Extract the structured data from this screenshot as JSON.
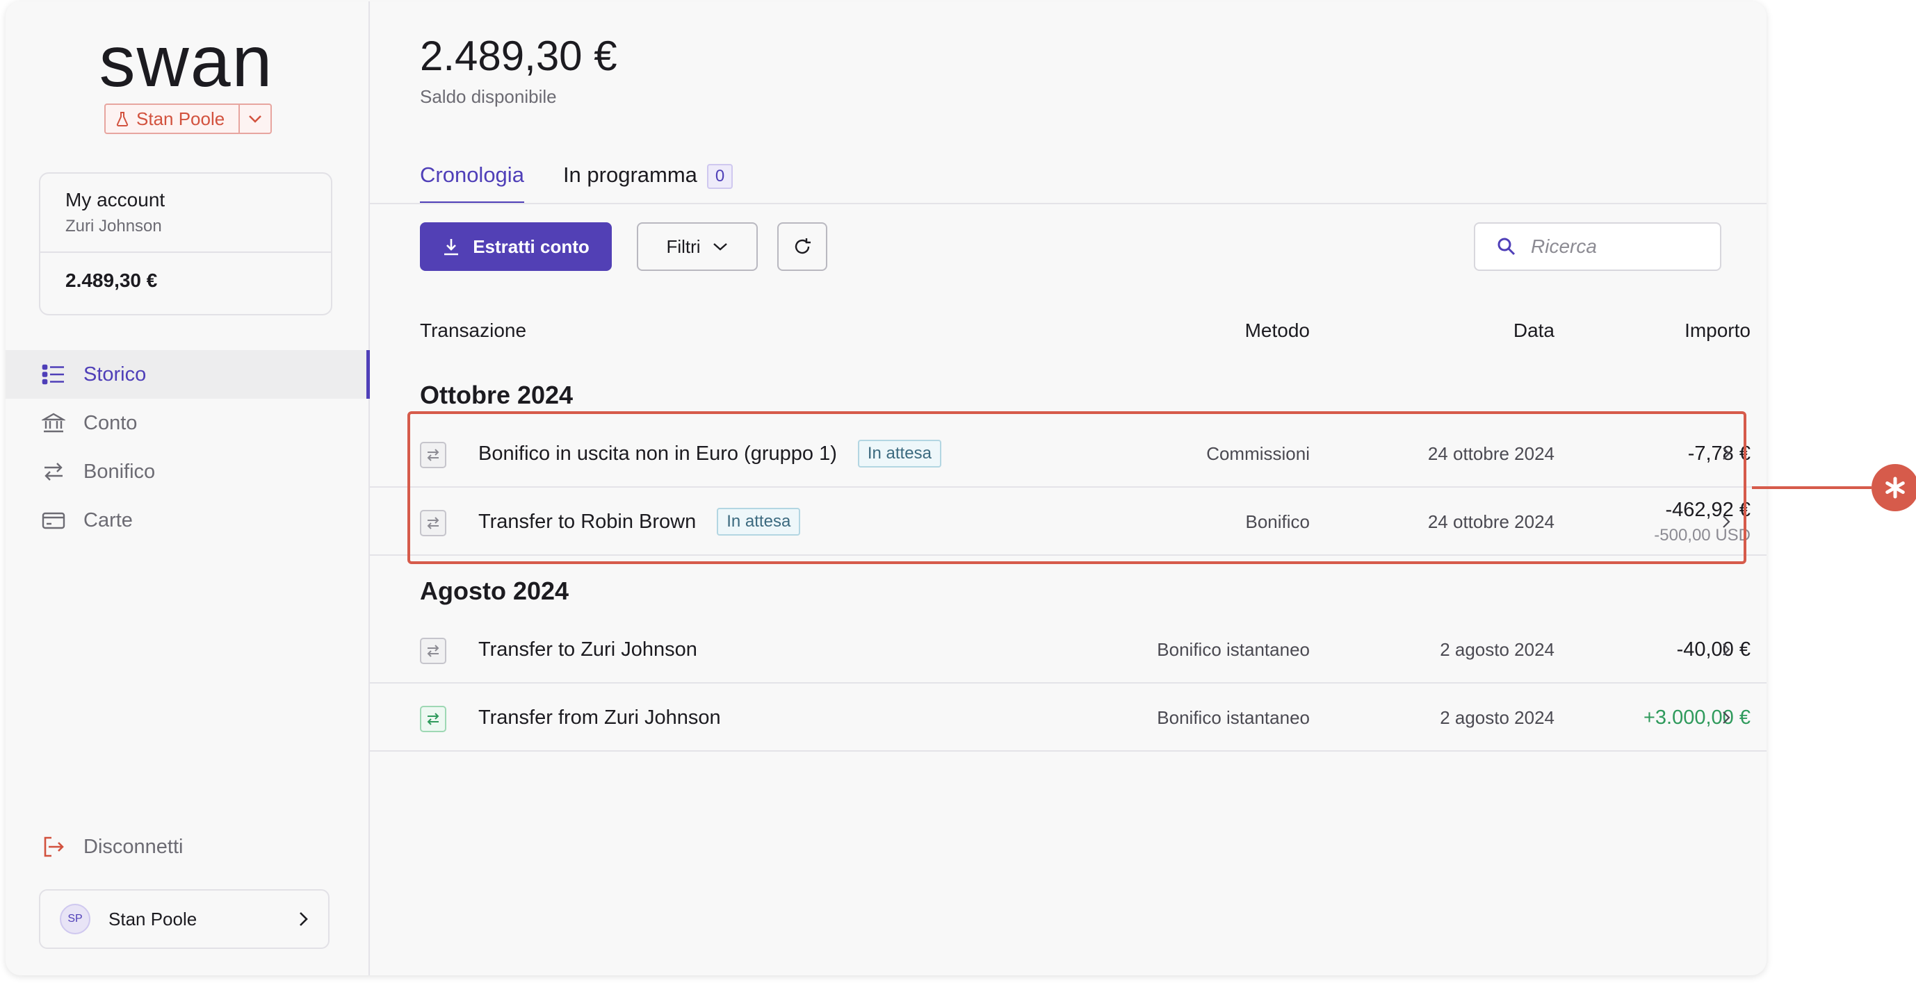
{
  "brand": {
    "logo_text": "swan"
  },
  "project": {
    "name": "Stan Poole"
  },
  "account_card": {
    "title": "My account",
    "holder": "Zuri Johnson",
    "balance": "2.489,30 €"
  },
  "nav": {
    "items": [
      {
        "label": "Storico",
        "icon": "list-icon",
        "active": true
      },
      {
        "label": "Conto",
        "icon": "bank-icon",
        "active": false
      },
      {
        "label": "Bonifico",
        "icon": "transfer-arrows-icon",
        "active": false
      },
      {
        "label": "Carte",
        "icon": "card-icon",
        "active": false
      }
    ],
    "logout": "Disconnetti"
  },
  "user": {
    "initials": "SP",
    "name": "Stan Poole"
  },
  "header": {
    "balance": "2.489,30 €",
    "balance_label": "Saldo disponibile"
  },
  "tabs": [
    {
      "label": "Cronologia",
      "active": true
    },
    {
      "label": "In programma",
      "count": "0",
      "active": false
    }
  ],
  "toolbar": {
    "statements_label": "Estratti conto",
    "filters_label": "Filtri",
    "search_placeholder": "Ricerca"
  },
  "table": {
    "columns": {
      "transaction": "Transazione",
      "method": "Metodo",
      "date": "Data",
      "amount": "Importo"
    },
    "groups": [
      {
        "title": "Ottobre 2024",
        "rows": [
          {
            "name": "Bonifico in uscita non in Euro (gruppo 1)",
            "badge": "In attesa",
            "method": "Commissioni",
            "date": "24 ottobre 2024",
            "amount": "-7,78 €",
            "sub_amount": ""
          },
          {
            "name": "Transfer to Robin Brown",
            "badge": "In attesa",
            "method": "Bonifico",
            "date": "24 ottobre 2024",
            "amount": "-462,92 €",
            "sub_amount": "-500,00 USD"
          }
        ]
      },
      {
        "title": "Agosto 2024",
        "rows": [
          {
            "name": "Transfer to Zuri Johnson",
            "badge": "",
            "method": "Bonifico istantaneo",
            "date": "2 agosto 2024",
            "amount": "-40,00 €",
            "sub_amount": ""
          },
          {
            "name": "Transfer from Zuri Johnson",
            "badge": "",
            "method": "Bonifico istantaneo",
            "date": "2 agosto 2024",
            "amount": "+3.000,00 €",
            "sub_amount": "",
            "positive": true
          }
        ]
      }
    ]
  },
  "colors": {
    "accent": "#5240b5",
    "highlight": "#d65b4b",
    "positive": "#2f9a5c",
    "pending_badge": "#3c6a7f"
  }
}
